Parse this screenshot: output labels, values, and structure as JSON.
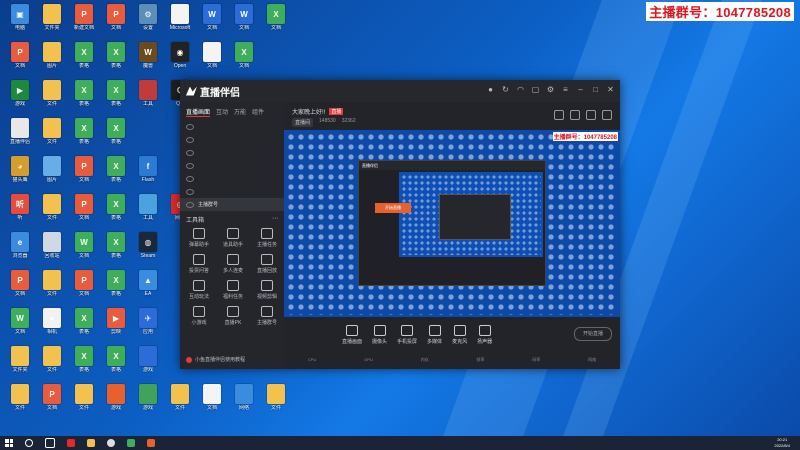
{
  "banner": {
    "text": "主播群号：1047785208"
  },
  "desktop": {
    "icons": [
      {
        "label": "电脑",
        "color": "#3a8dde",
        "col": 0,
        "row": 0,
        "glyph": "▣"
      },
      {
        "label": "文件夹",
        "color": "#f2c14e",
        "col": 1,
        "row": 0,
        "glyph": ""
      },
      {
        "label": "新建文档",
        "color": "#e85b3c",
        "col": 2,
        "row": 0,
        "glyph": "P"
      },
      {
        "label": "文档",
        "color": "#e85b3c",
        "col": 3,
        "row": 0,
        "glyph": "P"
      },
      {
        "label": "设置",
        "color": "#5b8fb9",
        "col": 4,
        "row": 0,
        "glyph": "⚙"
      },
      {
        "label": "Microsoft",
        "color": "#f4f4f4",
        "col": 5,
        "row": 0,
        "glyph": ""
      },
      {
        "label": "文档",
        "color": "#2b6cd8",
        "col": 6,
        "row": 0,
        "glyph": "W"
      },
      {
        "label": "文档",
        "color": "#2b6cd8",
        "col": 7,
        "row": 0,
        "glyph": "W"
      },
      {
        "label": "文档",
        "color": "#3fae5a",
        "col": 8,
        "row": 0,
        "glyph": "X"
      },
      {
        "label": "文档",
        "color": "#e85b3c",
        "col": 0,
        "row": 1,
        "glyph": "P"
      },
      {
        "label": "图片",
        "color": "#f2c14e",
        "col": 1,
        "row": 1,
        "glyph": ""
      },
      {
        "label": "表格",
        "color": "#3fae5a",
        "col": 2,
        "row": 1,
        "glyph": "X"
      },
      {
        "label": "表格",
        "color": "#3fae5a",
        "col": 3,
        "row": 1,
        "glyph": "X"
      },
      {
        "label": "魔兽",
        "color": "#6b4a1e",
        "col": 4,
        "row": 1,
        "glyph": "W"
      },
      {
        "label": "Open",
        "color": "#222222",
        "col": 5,
        "row": 1,
        "glyph": "◉"
      },
      {
        "label": "文档",
        "color": "#f4f4f4",
        "col": 6,
        "row": 1,
        "glyph": ""
      },
      {
        "label": "文档",
        "color": "#3fae5a",
        "col": 7,
        "row": 1,
        "glyph": "X"
      },
      {
        "label": "游戏",
        "color": "#1c8a3a",
        "col": 0,
        "row": 2,
        "glyph": "▶"
      },
      {
        "label": "文件",
        "color": "#f2c14e",
        "col": 1,
        "row": 2,
        "glyph": ""
      },
      {
        "label": "表格",
        "color": "#3fae5a",
        "col": 2,
        "row": 2,
        "glyph": "X"
      },
      {
        "label": "表格",
        "color": "#3fae5a",
        "col": 3,
        "row": 2,
        "glyph": "X"
      },
      {
        "label": "工具",
        "color": "#c23b3b",
        "col": 4,
        "row": 2,
        "glyph": ""
      },
      {
        "label": "QQ",
        "color": "#1f1f1f",
        "col": 5,
        "row": 2,
        "glyph": "Q"
      },
      {
        "label": "直播伴侣",
        "color": "#e8e8e8",
        "col": 0,
        "row": 3,
        "glyph": ""
      },
      {
        "label": "文件",
        "color": "#f2c14e",
        "col": 1,
        "row": 3,
        "glyph": ""
      },
      {
        "label": "表格",
        "color": "#3fae5a",
        "col": 2,
        "row": 3,
        "glyph": "X"
      },
      {
        "label": "表格",
        "color": "#3fae5a",
        "col": 3,
        "row": 3,
        "glyph": "X"
      },
      {
        "label": "猫头鹰",
        "color": "#d69c2c",
        "col": 0,
        "row": 4,
        "glyph": "◕"
      },
      {
        "label": "图片",
        "color": "#66aee8",
        "col": 1,
        "row": 4,
        "glyph": ""
      },
      {
        "label": "文档",
        "color": "#e85b3c",
        "col": 2,
        "row": 4,
        "glyph": "P"
      },
      {
        "label": "表格",
        "color": "#3fae5a",
        "col": 3,
        "row": 4,
        "glyph": "X"
      },
      {
        "label": "Flash",
        "color": "#2b7bd6",
        "col": 4,
        "row": 4,
        "glyph": "f"
      },
      {
        "label": "听",
        "color": "#e64b3b",
        "col": 0,
        "row": 5,
        "glyph": "听"
      },
      {
        "label": "文件",
        "color": "#f2c14e",
        "col": 1,
        "row": 5,
        "glyph": ""
      },
      {
        "label": "文档",
        "color": "#e85b3c",
        "col": 2,
        "row": 5,
        "glyph": "P"
      },
      {
        "label": "表格",
        "color": "#3fae5a",
        "col": 3,
        "row": 5,
        "glyph": "X"
      },
      {
        "label": "工具",
        "color": "#4aa3df",
        "col": 4,
        "row": 5,
        "glyph": ""
      },
      {
        "label": "网易",
        "color": "#e12b2b",
        "col": 5,
        "row": 5,
        "glyph": "◎"
      },
      {
        "label": "浏览器",
        "color": "#3a8dde",
        "col": 0,
        "row": 6,
        "glyph": "e"
      },
      {
        "label": "回收站",
        "color": "#cfd8e3",
        "col": 1,
        "row": 6,
        "glyph": ""
      },
      {
        "label": "文档",
        "color": "#3fae5a",
        "col": 2,
        "row": 6,
        "glyph": "W"
      },
      {
        "label": "表格",
        "color": "#3fae5a",
        "col": 3,
        "row": 6,
        "glyph": "X"
      },
      {
        "label": "Steam",
        "color": "#1b2838",
        "col": 4,
        "row": 6,
        "glyph": "◍"
      },
      {
        "label": "文档",
        "color": "#e85b3c",
        "col": 0,
        "row": 7,
        "glyph": "P"
      },
      {
        "label": "文件",
        "color": "#f2c14e",
        "col": 1,
        "row": 7,
        "glyph": ""
      },
      {
        "label": "文档",
        "color": "#e85b3c",
        "col": 2,
        "row": 7,
        "glyph": "P"
      },
      {
        "label": "表格",
        "color": "#3fae5a",
        "col": 3,
        "row": 7,
        "glyph": "X"
      },
      {
        "label": "EA",
        "color": "#3a8dde",
        "col": 4,
        "row": 7,
        "glyph": "▲"
      },
      {
        "label": "文档",
        "color": "#3fae5a",
        "col": 0,
        "row": 8,
        "glyph": "W"
      },
      {
        "label": "相机",
        "color": "#f2f2f2",
        "col": 1,
        "row": 8,
        "glyph": "●"
      },
      {
        "label": "表格",
        "color": "#3fae5a",
        "col": 2,
        "row": 8,
        "glyph": "X"
      },
      {
        "label": "剪映",
        "color": "#e85b3c",
        "col": 3,
        "row": 8,
        "glyph": "▶"
      },
      {
        "label": "应用",
        "color": "#2b6cd8",
        "col": 4,
        "row": 8,
        "glyph": "✈"
      },
      {
        "label": "文件夹",
        "color": "#f2c14e",
        "col": 0,
        "row": 9,
        "glyph": ""
      },
      {
        "label": "文件",
        "color": "#f2c14e",
        "col": 1,
        "row": 9,
        "glyph": ""
      },
      {
        "label": "表格",
        "color": "#3fae5a",
        "col": 2,
        "row": 9,
        "glyph": "X"
      },
      {
        "label": "表格",
        "color": "#3fae5a",
        "col": 3,
        "row": 9,
        "glyph": "X"
      },
      {
        "label": "游戏",
        "color": "#2b6cd8",
        "col": 4,
        "row": 9,
        "glyph": ""
      },
      {
        "label": "文件",
        "color": "#f2c14e",
        "col": 0,
        "row": 10,
        "glyph": ""
      },
      {
        "label": "文档",
        "color": "#e85b3c",
        "col": 1,
        "row": 10,
        "glyph": "P"
      },
      {
        "label": "文件",
        "color": "#f2c14e",
        "col": 2,
        "row": 10,
        "glyph": ""
      },
      {
        "label": "游戏",
        "color": "#e8612c",
        "col": 3,
        "row": 10,
        "glyph": ""
      },
      {
        "label": "游戏",
        "color": "#41a35a",
        "col": 4,
        "row": 10,
        "glyph": ""
      },
      {
        "label": "文件",
        "color": "#f2c14e",
        "col": 5,
        "row": 10,
        "glyph": ""
      },
      {
        "label": "文档",
        "color": "#f4f4f4",
        "col": 6,
        "row": 10,
        "glyph": ""
      },
      {
        "label": "网络",
        "color": "#3a8dde",
        "col": 7,
        "row": 10,
        "glyph": ""
      },
      {
        "label": "文件",
        "color": "#f2c14e",
        "col": 8,
        "row": 10,
        "glyph": ""
      }
    ]
  },
  "app": {
    "logo_text": "直播伴侣",
    "tabs": [
      "直播画面",
      "互动",
      "万能",
      "组件"
    ],
    "scenes": [
      "",
      "",
      "",
      "",
      "",
      "",
      "主播群号"
    ],
    "tools_title": "工具箱",
    "tools": [
      "弹幕助手",
      "道具助手",
      "主播任务",
      "投票问答",
      "多人连麦",
      "直播回放",
      "互动玩法",
      "福利任务",
      "视频剪辑",
      "小游戏",
      "直播PK",
      "主播群号"
    ],
    "notice": "小鱼直播伴侣使用教程",
    "room_title": "大家晚上好!!",
    "room_tag": "直播",
    "room_meta": [
      "直播间",
      "148530",
      "32362"
    ],
    "bottom_tools": [
      "直播画面",
      "摄像头",
      "手机投屏",
      "多媒体",
      "麦克风",
      "扬声器"
    ],
    "start_live": "开始直播",
    "status": [
      "CPU",
      "GPU",
      "内存",
      "帧率",
      "码率",
      "网络"
    ],
    "nested_orange": "开始直播"
  },
  "taskbar": {
    "time": "20:21",
    "date": "2022/8/4"
  }
}
